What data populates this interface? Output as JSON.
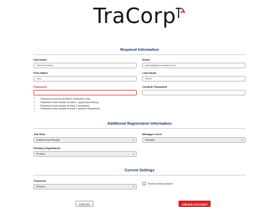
{
  "brand": {
    "name": "TraCorp",
    "mark_color": "#c0392b"
  },
  "required": {
    "title": "Required Information",
    "username": {
      "label": "Username",
      "placeholder": "YourUsername"
    },
    "email": {
      "label": "Email",
      "placeholder": "person@yourcompany.com"
    },
    "first_name": {
      "label": "First Name",
      "placeholder": "Your"
    },
    "last_name": {
      "label": "Last Name",
      "placeholder": "Name"
    },
    "password": {
      "label": "Password",
      "value": ""
    },
    "confirm_password": {
      "label": "Confirm Password",
      "value": ""
    },
    "password_rules": [
      "Password must be at least 8 characters long.",
      "Password must contain at least 1 uppercase letter(s)",
      "Password must contain at least 1 number(s)",
      "Password must contain at least 1 special character(s)"
    ]
  },
  "additional": {
    "title": "Additional Registration Information",
    "job_role": {
      "label": "Job Role",
      "value": "Engineering Manager"
    },
    "manager_level": {
      "label": "Manager Level",
      "value": "Manager"
    },
    "primary_department": {
      "label": "Primary Department",
      "value": "Product"
    }
  },
  "current": {
    "title": "Current Settings",
    "timezone": {
      "label": "Timezone",
      "value": "Phoenix"
    },
    "receive_email": {
      "label": "Receive Email Notices",
      "checked": false
    }
  },
  "actions": {
    "cancel": "CANCEL",
    "create": "CREATE ACCOUNT"
  },
  "colors": {
    "accent": "#d9252a",
    "section_title": "#1d3a6b",
    "error": "#c0392b"
  }
}
